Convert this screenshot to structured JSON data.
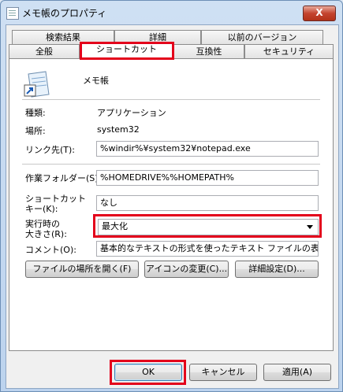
{
  "window": {
    "title": "メモ帳のプロパティ",
    "close_glyph": "X"
  },
  "tabs_top": [
    "検索結果",
    "詳細",
    "以前のバージョン"
  ],
  "tabs_bottom": [
    "全般",
    "ショートカット",
    "互換性",
    "セキュリティ"
  ],
  "app_name": "メモ帳",
  "labels": {
    "type": "種類:",
    "location": "場所:",
    "target": "リンク先(T):",
    "start_in": "作業フォルダー(S):",
    "shortcut_key_1": "ショートカット",
    "shortcut_key_2": "キー(K):",
    "run_1": "実行時の",
    "run_2": "大きさ(R):",
    "comment": "コメント(O):"
  },
  "values": {
    "type": "アプリケーション",
    "location": "system32",
    "target": "%windir%¥system32¥notepad.exe",
    "start_in": "%HOMEDRIVE%%HOMEPATH%",
    "shortcut_key": "なし",
    "run": "最大化",
    "comment": "基本的なテキストの形式を使ったテキスト ファイルの表示と編集"
  },
  "panel_buttons": {
    "open_location": "ファイルの場所を開く(F)",
    "change_icon": "アイコンの変更(C)...",
    "advanced": "詳細設定(D)..."
  },
  "dialog_buttons": {
    "ok": "OK",
    "cancel": "キャンセル",
    "apply": "適用(A)"
  },
  "colors": {
    "highlight": "#e3001b",
    "titlebar": "#c4d8f0"
  }
}
